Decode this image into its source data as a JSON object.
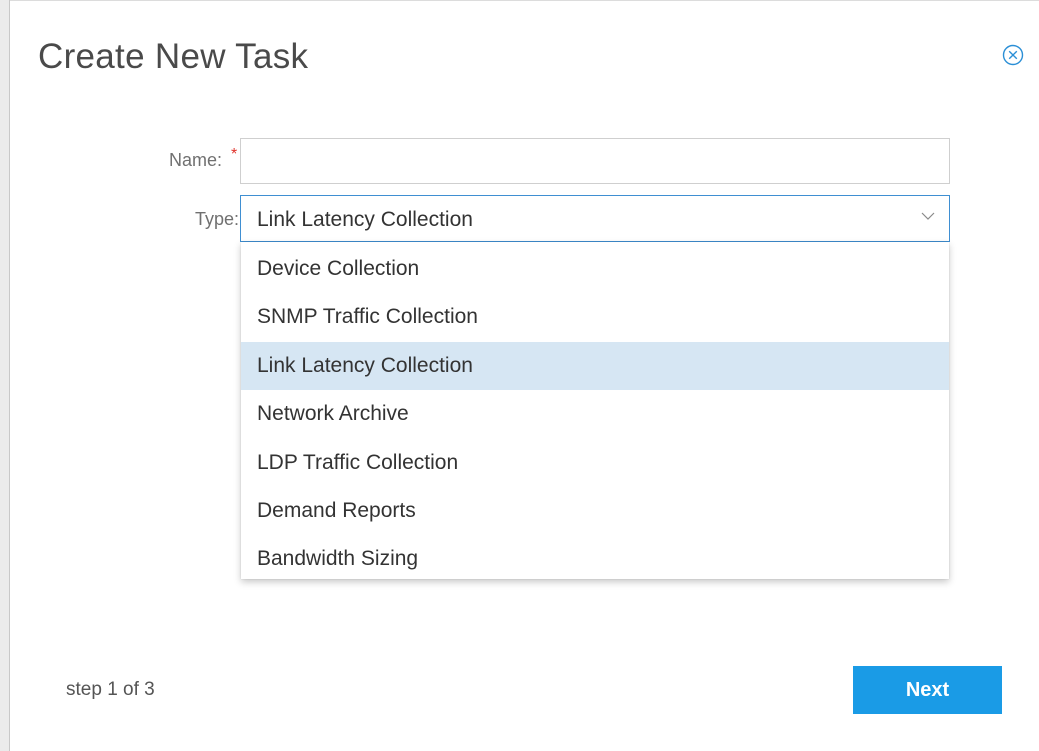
{
  "dialog": {
    "title": "Create New Task",
    "close_icon": "close-circle-icon"
  },
  "form": {
    "name": {
      "label": "Name:",
      "required_mark": "*",
      "value": "",
      "placeholder": ""
    },
    "type": {
      "label": "Type:",
      "selected_value": "Link Latency Collection",
      "options": [
        "Device Collection",
        "SNMP Traffic Collection",
        "Link Latency Collection",
        "Network Archive",
        "LDP Traffic Collection",
        "Demand Reports",
        "Bandwidth Sizing"
      ],
      "highlighted_index": 2
    }
  },
  "footer": {
    "step_text": "step 1 of 3",
    "next_label": "Next"
  },
  "colors": {
    "accent": "#1a9be6",
    "focus_border": "#3f8fd2",
    "highlight": "#d6e6f3",
    "required": "#e0312a"
  }
}
